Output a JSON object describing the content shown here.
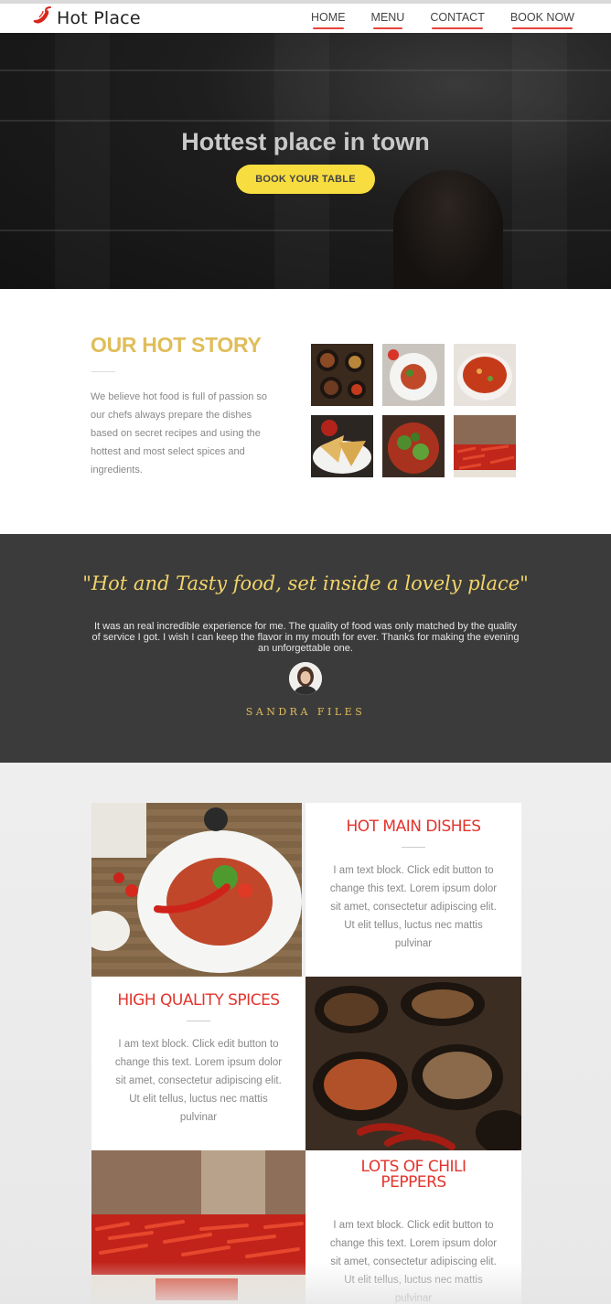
{
  "header": {
    "logo_text": "Hot Place",
    "logo_icon": "chili-pepper-icon",
    "nav": [
      "HOME",
      "MENU",
      "CONTACT",
      "BOOK NOW"
    ]
  },
  "hero": {
    "title": "Hottest place in town",
    "button": "BOOK YOUR TABLE"
  },
  "story": {
    "title": "OUR HOT STORY",
    "text": "We believe hot food is full of passion so our chefs always prepare the dishes based on secret recipes and using the hottest and most select spices and ingredients."
  },
  "testimonial": {
    "quote": "\"Hot and Tasty food, set inside a lovely place\"",
    "body": "It was an real incredible experience for me. The quality of food was only matched by the quality of service I got. I wish I can keep the flavor in my mouth for ever. Thanks for making the evening an unforgettable one.",
    "author": "SANDRA FILES"
  },
  "features": [
    {
      "title": "HOT MAIN DISHES",
      "text": "I am text block. Click edit button to change this text. Lorem ipsum dolor sit amet, consectetur adipiscing elit. Ut elit tellus, luctus nec mattis pulvinar"
    },
    {
      "title": "HIGH QUALITY SPICES",
      "text": "I am text block. Click edit button to change this text. Lorem ipsum dolor sit amet, consectetur adipiscing elit. Ut elit tellus, luctus nec mattis pulvinar"
    },
    {
      "title": "LOTS OF CHILI PEPPERS",
      "text": "I am text block. Click edit button to change this text. Lorem ipsum dolor sit amet, consectetur adipiscing elit. Ut elit tellus, luctus nec mattis pulvinar"
    }
  ],
  "colors": {
    "accent_red": "#e8413a",
    "yellow": "#f7dd3f",
    "gold": "#e0bd5a",
    "dark_band": "#3b3b3b"
  }
}
